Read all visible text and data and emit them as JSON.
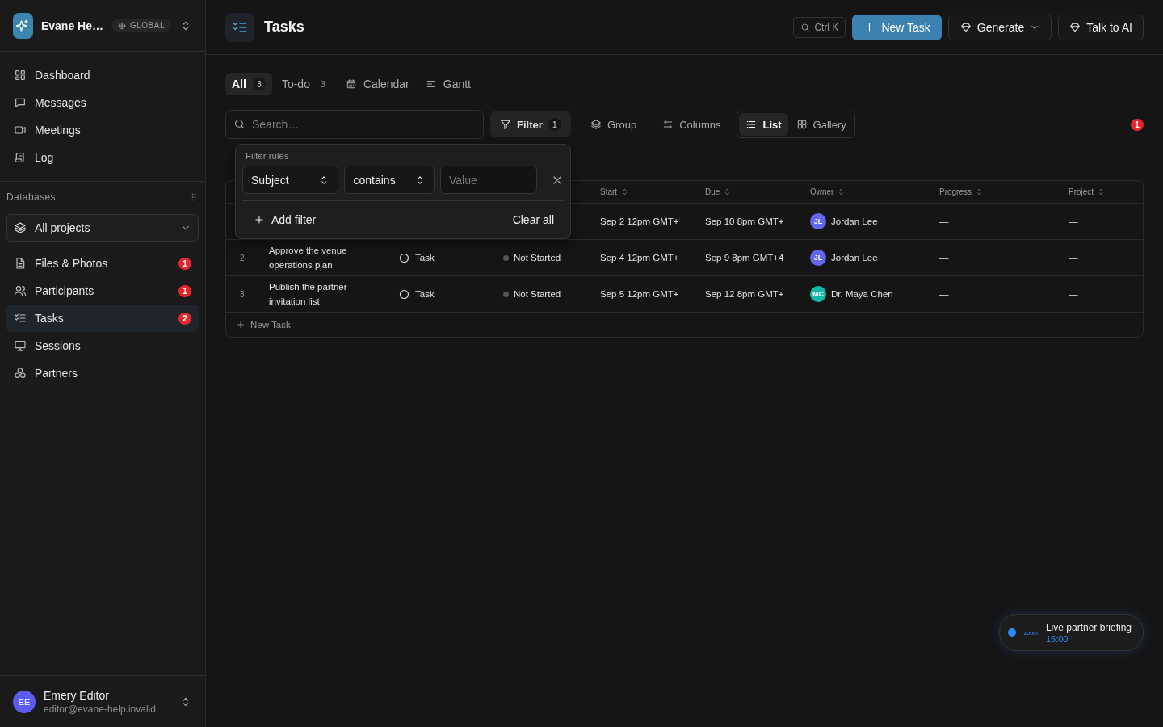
{
  "workspace": {
    "name": "Evane He…",
    "scope": "GLOBAL"
  },
  "nav": [
    {
      "label": "Dashboard"
    },
    {
      "label": "Messages"
    },
    {
      "label": "Meetings"
    },
    {
      "label": "Log"
    }
  ],
  "databases": {
    "title": "Databases",
    "project_picker": "All projects",
    "items": [
      {
        "label": "Files & Photos",
        "badge": "1",
        "selected": false
      },
      {
        "label": "Participants",
        "badge": "1",
        "selected": false
      },
      {
        "label": "Tasks",
        "badge": "2",
        "selected": true
      },
      {
        "label": "Sessions",
        "selected": false
      },
      {
        "label": "Partners",
        "selected": false
      }
    ]
  },
  "user": {
    "initials": "EE",
    "name": "Emery Editor",
    "email": "editor@evane-help.invalid"
  },
  "header": {
    "title": "Tasks",
    "shortcut": "Ctrl K",
    "new_button": "New Task",
    "generate_button": "Generate",
    "ai_button": "Talk to AI"
  },
  "views": [
    {
      "label": "All",
      "count": "3",
      "selected": true
    },
    {
      "label": "To-do",
      "count": "3",
      "selected": false
    },
    {
      "label": "Calendar",
      "selected": false
    },
    {
      "label": "Gantt",
      "selected": false
    }
  ],
  "toolbar": {
    "search_placeholder": "Search…",
    "filter": {
      "label": "Filter",
      "count": "1"
    },
    "group": "Group",
    "columns": "Columns",
    "layouts": [
      {
        "label": "List",
        "selected": true
      },
      {
        "label": "Gallery",
        "selected": false
      }
    ],
    "alert_count": "1"
  },
  "filter_rules": {
    "title": "Filter rules",
    "rules": [
      {
        "field": "Subject",
        "operator": "contains",
        "placeholder": "Value"
      }
    ],
    "add": "Add filter",
    "clear": "Clear all"
  },
  "table": {
    "columns": [
      "Start",
      "Due",
      "Owner",
      "Progress",
      "Project"
    ],
    "rows": [
      {
        "start": "Sep 2 12pm GMT+",
        "due": "Sep 10 8pm GMT+",
        "owner": {
          "initials": "JL",
          "name": "Jordan Lee",
          "color": "#6366f1"
        },
        "progress": "—",
        "project": "—"
      },
      {
        "number": "2",
        "subject": "Approve the venue operations plan",
        "type": "Task",
        "status": "Not Started",
        "start": "Sep 4 12pm GMT+",
        "due": "Sep 9 8pm GMT+4",
        "owner": {
          "initials": "JL",
          "name": "Jordan Lee",
          "color": "#6366f1"
        },
        "progress": "—",
        "project": "—"
      },
      {
        "number": "3",
        "subject": "Publish the partner invitation list",
        "type": "Task",
        "status": "Not Started",
        "start": "Sep 5 12pm GMT+",
        "due": "Sep 12 8pm GMT+",
        "owner": {
          "initials": "MC",
          "name": "Dr. Maya Chen",
          "color": "#14b8a6"
        },
        "progress": "—",
        "project": "—"
      }
    ],
    "new_row": "New Task"
  },
  "meeting": {
    "provider": "zoom",
    "title": "Live partner briefing",
    "time": "15:00"
  }
}
